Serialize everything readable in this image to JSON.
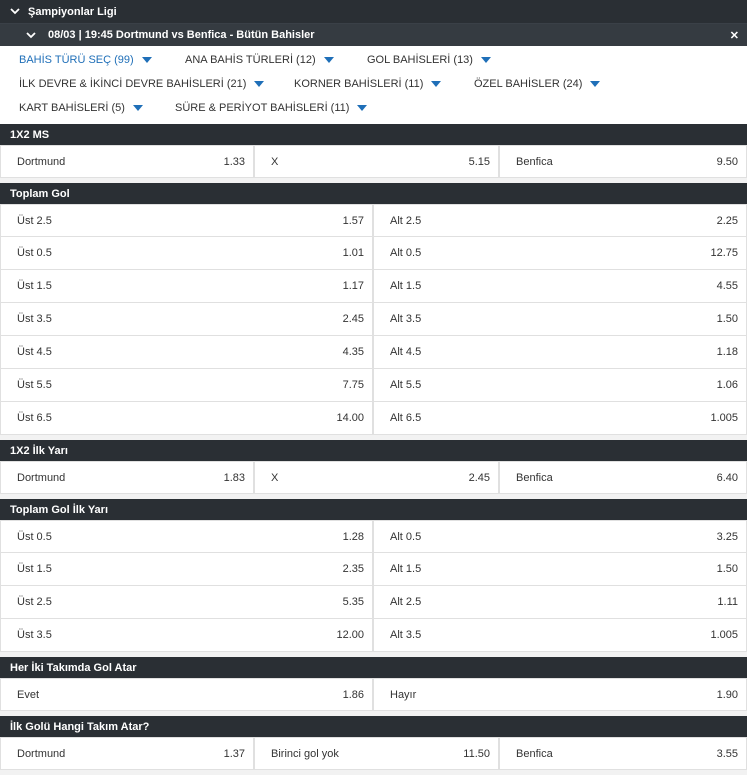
{
  "league": "Şampiyonlar Ligi",
  "event": "08/03 | 19:45 Dortmund vs Benfica - Bütün Bahisler",
  "close_glyph": "✕",
  "filters": [
    [
      {
        "label": "BAHİS TÜRÜ SEÇ (99)",
        "active": true
      },
      {
        "label": "ANA BAHİS TÜRLERİ (12)"
      },
      {
        "label": "GOL BAHİSLERİ (13)"
      }
    ],
    [
      {
        "label": "İLK DEVRE & İKİNCİ DEVRE BAHİSLERİ (21)"
      },
      {
        "label": "KORNER BAHİSLERİ (11)"
      },
      {
        "label": "ÖZEL BAHİSLER (24)"
      }
    ],
    [
      {
        "label": "KART BAHİSLERİ (5)"
      },
      {
        "label": "SÜRE & PERİYOT BAHİSLERİ (11)"
      }
    ]
  ],
  "sections": [
    {
      "title": "1X2 MS",
      "cols": 3,
      "rows": [
        [
          {
            "name": "Dortmund",
            "odd": "1.33"
          },
          {
            "name": "X",
            "odd": "5.15"
          },
          {
            "name": "Benfica",
            "odd": "9.50"
          }
        ]
      ]
    },
    {
      "title": "Toplam Gol",
      "cols": 2,
      "rows": [
        [
          {
            "name": "Üst 2.5",
            "odd": "1.57"
          },
          {
            "name": "Alt 2.5",
            "odd": "2.25"
          }
        ],
        [
          {
            "name": "Üst 0.5",
            "odd": "1.01"
          },
          {
            "name": "Alt 0.5",
            "odd": "12.75"
          }
        ],
        [
          {
            "name": "Üst 1.5",
            "odd": "1.17"
          },
          {
            "name": "Alt 1.5",
            "odd": "4.55"
          }
        ],
        [
          {
            "name": "Üst 3.5",
            "odd": "2.45"
          },
          {
            "name": "Alt 3.5",
            "odd": "1.50"
          }
        ],
        [
          {
            "name": "Üst 4.5",
            "odd": "4.35"
          },
          {
            "name": "Alt 4.5",
            "odd": "1.18"
          }
        ],
        [
          {
            "name": "Üst 5.5",
            "odd": "7.75"
          },
          {
            "name": "Alt 5.5",
            "odd": "1.06"
          }
        ],
        [
          {
            "name": "Üst 6.5",
            "odd": "14.00"
          },
          {
            "name": "Alt 6.5",
            "odd": "1.005"
          }
        ]
      ]
    },
    {
      "title": "1X2 İlk Yarı",
      "cols": 3,
      "rows": [
        [
          {
            "name": "Dortmund",
            "odd": "1.83"
          },
          {
            "name": "X",
            "odd": "2.45"
          },
          {
            "name": "Benfica",
            "odd": "6.40"
          }
        ]
      ]
    },
    {
      "title": "Toplam Gol İlk Yarı",
      "cols": 2,
      "rows": [
        [
          {
            "name": "Üst 0.5",
            "odd": "1.28"
          },
          {
            "name": "Alt 0.5",
            "odd": "3.25"
          }
        ],
        [
          {
            "name": "Üst 1.5",
            "odd": "2.35"
          },
          {
            "name": "Alt 1.5",
            "odd": "1.50"
          }
        ],
        [
          {
            "name": "Üst 2.5",
            "odd": "5.35"
          },
          {
            "name": "Alt 2.5",
            "odd": "1.11"
          }
        ],
        [
          {
            "name": "Üst 3.5",
            "odd": "12.00"
          },
          {
            "name": "Alt 3.5",
            "odd": "1.005"
          }
        ]
      ]
    },
    {
      "title": "Her İki Takımda Gol Atar",
      "cols": 2,
      "rows": [
        [
          {
            "name": "Evet",
            "odd": "1.86"
          },
          {
            "name": "Hayır",
            "odd": "1.90"
          }
        ]
      ]
    },
    {
      "title": "İlk Golü Hangi Takım Atar?",
      "cols": 3,
      "rows": [
        [
          {
            "name": "Dortmund",
            "odd": "1.37"
          },
          {
            "name": "Birinci gol yok",
            "odd": "11.50"
          },
          {
            "name": "Benfica",
            "odd": "3.55"
          }
        ]
      ]
    }
  ]
}
